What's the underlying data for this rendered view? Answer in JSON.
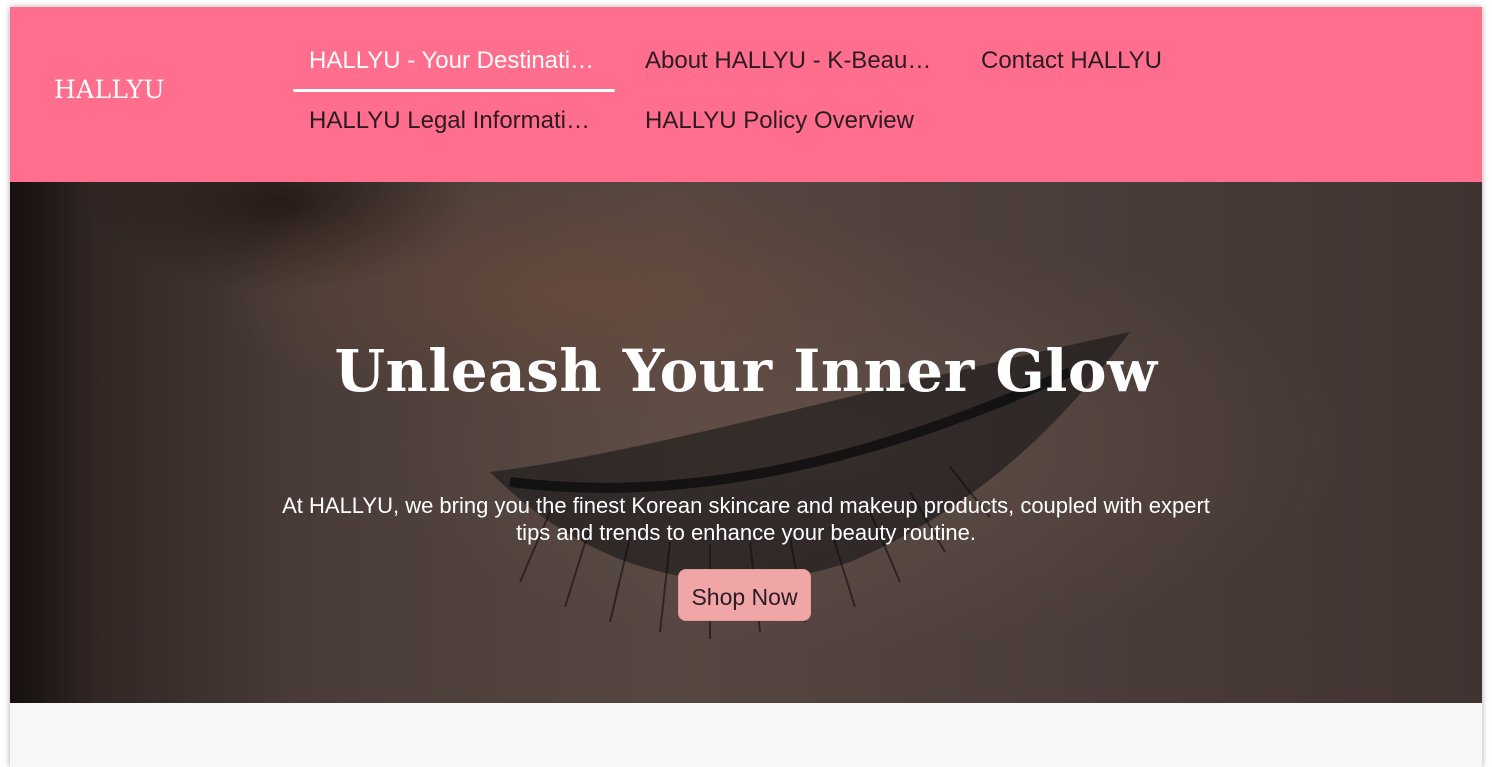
{
  "site": {
    "logo": "HALLYU"
  },
  "nav": {
    "items": [
      {
        "label": "HALLYU - Your Destination for Korean Beauty",
        "active": true
      },
      {
        "label": "About HALLYU - K-Beauty Experts",
        "active": false
      },
      {
        "label": "Contact HALLYU",
        "active": false
      },
      {
        "label": "HALLYU Legal Information",
        "active": false
      },
      {
        "label": "HALLYU Policy Overview",
        "active": false
      }
    ]
  },
  "hero": {
    "title": "Unleash Your Inner Glow",
    "text": "At HALLYU, we bring you the finest Korean skincare and makeup products, coupled with expert tips and trends to enhance your beauty routine.",
    "cta_label": "Shop Now"
  },
  "colors": {
    "header_bg": "#ff6e8c",
    "cta_bg": "#f0a6a6",
    "page_bg": "#f7f7f7"
  }
}
